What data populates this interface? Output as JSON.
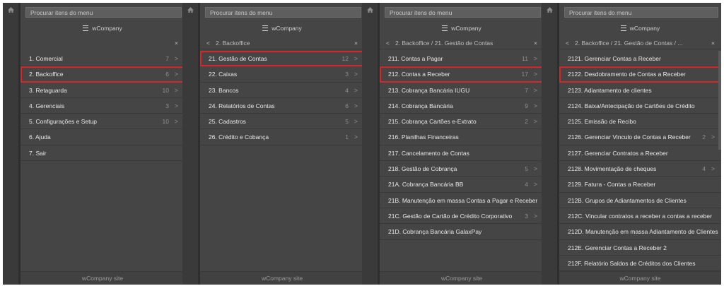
{
  "search_placeholder": "Procurar itens do menu",
  "brand": "wCompany",
  "footer": "wCompany site",
  "panels": [
    {
      "crumb": "",
      "items": [
        {
          "label": "1. Comercial",
          "count": "7"
        },
        {
          "label": "2. Backoffice",
          "count": "6"
        },
        {
          "label": "3. Retaguarda",
          "count": "10"
        },
        {
          "label": "4. Gerenciais",
          "count": "3"
        },
        {
          "label": "5. Configurações e Setup",
          "count": "10"
        },
        {
          "label": "6. Ajuda",
          "count": ""
        },
        {
          "label": "7. Sair",
          "count": ""
        }
      ]
    },
    {
      "crumb": "2. Backoffice",
      "items": [
        {
          "label": "21. Gestão de Contas",
          "count": "12"
        },
        {
          "label": "22. Caixas",
          "count": "3"
        },
        {
          "label": "23. Bancos",
          "count": "4"
        },
        {
          "label": "24. Relatórios de Contas",
          "count": "6"
        },
        {
          "label": "25. Cadastros",
          "count": "5"
        },
        {
          "label": "26. Crédito e Cobança",
          "count": "1"
        }
      ]
    },
    {
      "crumb": "2. Backoffice / 21. Gestão de Contas",
      "items": [
        {
          "label": "211. Contas a Pagar",
          "count": "11"
        },
        {
          "label": "212. Contas a Receber",
          "count": "17"
        },
        {
          "label": "213. Cobrança Bancária IUGU",
          "count": "7"
        },
        {
          "label": "214. Cobrança Bancária",
          "count": "9"
        },
        {
          "label": "215. Cobrança Cartões e-Extrato",
          "count": "2"
        },
        {
          "label": "216. Planilhas Financeiras",
          "count": ""
        },
        {
          "label": "217. Cancelamento de Contas",
          "count": ""
        },
        {
          "label": "218. Gestão de Cobrança",
          "count": "5"
        },
        {
          "label": "21A. Cobrança Bancária BB",
          "count": "4"
        },
        {
          "label": "21B. Manutenção em massa Contas a Pagar e Receber",
          "count": ""
        },
        {
          "label": "21C. Gestão de Cartão de Crédito Corporativo",
          "count": "3"
        },
        {
          "label": "21D. Cobrança Bancária GalaxPay",
          "count": ""
        }
      ]
    },
    {
      "crumb": "2. Backoffice / 21. Gestão de Contas / ...",
      "items": [
        {
          "label": "2121. Gerenciar Contas a Receber",
          "count": ""
        },
        {
          "label": "2122. Desdobramento de Contas a Receber",
          "count": ""
        },
        {
          "label": "2123. Adiantamento de clientes",
          "count": ""
        },
        {
          "label": "2124. Baixa/Antecipação de Cartões de Crédito",
          "count": ""
        },
        {
          "label": "2125. Emissão de Recibo",
          "count": ""
        },
        {
          "label": "2126. Gerenciar Vinculo de Contas a Receber",
          "count": "2"
        },
        {
          "label": "2127. Gerenciar Contratos a Receber",
          "count": ""
        },
        {
          "label": "2128. Movimentação de cheques",
          "count": "4"
        },
        {
          "label": "2129. Fatura - Contas a Receber",
          "count": ""
        },
        {
          "label": "212B. Grupos de Adiantamentos de Clientes",
          "count": ""
        },
        {
          "label": "212C. Vincular contratos a receber a contas a receber",
          "count": ""
        },
        {
          "label": "212D. Manutenção em massa Adiantamento de Clientes",
          "count": ""
        },
        {
          "label": "212E. Gerenciar Contas a Receber 2",
          "count": ""
        },
        {
          "label": "212F. Relatório Saldos de Créditos dos Clientes",
          "count": ""
        }
      ]
    }
  ],
  "colors": {
    "highlight": "#d6262a",
    "panel": "#454545",
    "strip": "#3a3a3a"
  }
}
